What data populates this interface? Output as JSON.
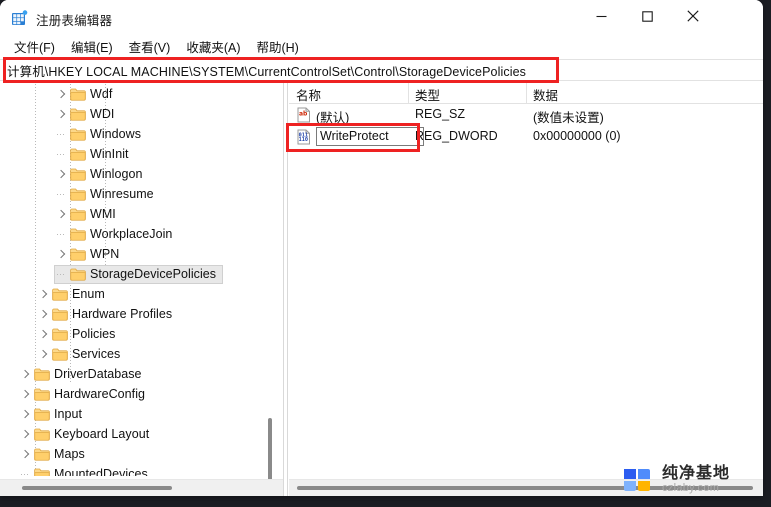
{
  "window": {
    "title": "注册表编辑器",
    "icon": "registry-editor-icon",
    "minimize_label": "−",
    "maximize_label": "□",
    "close_label": "✕"
  },
  "menubar": {
    "items": [
      {
        "label": "文件(F)"
      },
      {
        "label": "编辑(E)"
      },
      {
        "label": "查看(V)"
      },
      {
        "label": "收藏夹(A)"
      },
      {
        "label": "帮助(H)"
      }
    ]
  },
  "address": {
    "value": "计算机\\HKEY LOCAL MACHINE\\SYSTEM\\CurrentControlSet\\Control\\StorageDevicePolicies"
  },
  "tree": {
    "items": [
      {
        "label": "Wdf",
        "indent": 3,
        "expandable": true,
        "selected": false
      },
      {
        "label": "WDI",
        "indent": 3,
        "expandable": true,
        "selected": false
      },
      {
        "label": "Windows",
        "indent": 3,
        "expandable": false,
        "selected": false
      },
      {
        "label": "WinInit",
        "indent": 3,
        "expandable": false,
        "selected": false
      },
      {
        "label": "Winlogon",
        "indent": 3,
        "expandable": true,
        "selected": false
      },
      {
        "label": "Winresume",
        "indent": 3,
        "expandable": false,
        "selected": false
      },
      {
        "label": "WMI",
        "indent": 3,
        "expandable": true,
        "selected": false
      },
      {
        "label": "WorkplaceJoin",
        "indent": 3,
        "expandable": false,
        "selected": false
      },
      {
        "label": "WPN",
        "indent": 3,
        "expandable": true,
        "selected": false
      },
      {
        "label": "StorageDevicePolicies",
        "indent": 3,
        "expandable": false,
        "selected": true
      },
      {
        "label": "Enum",
        "indent": 2,
        "expandable": true,
        "selected": false
      },
      {
        "label": "Hardware Profiles",
        "indent": 2,
        "expandable": true,
        "selected": false
      },
      {
        "label": "Policies",
        "indent": 2,
        "expandable": true,
        "selected": false
      },
      {
        "label": "Services",
        "indent": 2,
        "expandable": true,
        "selected": false
      },
      {
        "label": "DriverDatabase",
        "indent": 1,
        "expandable": true,
        "selected": false
      },
      {
        "label": "HardwareConfig",
        "indent": 1,
        "expandable": true,
        "selected": false
      },
      {
        "label": "Input",
        "indent": 1,
        "expandable": true,
        "selected": false
      },
      {
        "label": "Keyboard Layout",
        "indent": 1,
        "expandable": true,
        "selected": false
      },
      {
        "label": "Maps",
        "indent": 1,
        "expandable": true,
        "selected": false
      },
      {
        "label": "MountedDevices",
        "indent": 1,
        "expandable": false,
        "selected": false
      }
    ]
  },
  "list": {
    "columns": [
      {
        "label": "名称"
      },
      {
        "label": "类型"
      },
      {
        "label": "数据"
      }
    ],
    "rows": [
      {
        "icon": "string-value-icon",
        "name": "(默认)",
        "type": "REG_SZ",
        "data": "(数值未设置)",
        "editing": false
      },
      {
        "icon": "dword-value-icon",
        "name": "WriteProtect",
        "type": "REG_DWORD",
        "data": "0x00000000 (0)",
        "editing": true
      }
    ]
  },
  "annotations": {
    "color": "#ee2222",
    "boxes": [
      {
        "name": "address-highlight"
      },
      {
        "name": "value-name-highlight"
      }
    ]
  },
  "watermark": {
    "title": "纯净基地",
    "subtitle": "czlaby.com",
    "colors": {
      "blue_dark": "#2b5cf0",
      "blue_light": "#6aa6fb",
      "yellow": "#ffb400"
    }
  }
}
